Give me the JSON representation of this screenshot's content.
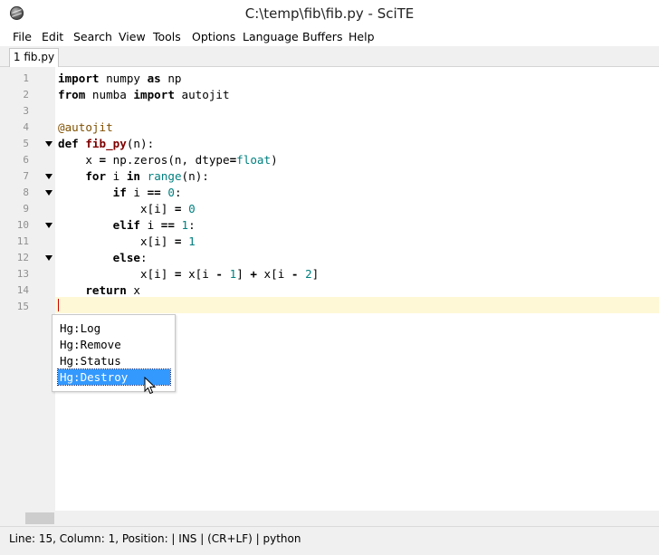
{
  "window": {
    "title": "C:\\temp\\fib\\fib.py - SciTE"
  },
  "menu": [
    "File",
    "Edit",
    "Search",
    "View",
    "Tools",
    "Options",
    "Language",
    "Buffers",
    "Help"
  ],
  "tabs": [
    {
      "label": "1 fib.py"
    }
  ],
  "editor": {
    "line_numbers": [
      "1",
      "2",
      "3",
      "4",
      "5",
      "6",
      "7",
      "8",
      "9",
      "10",
      "11",
      "12",
      "13",
      "14",
      "15"
    ],
    "lines": [
      "import numpy as np",
      "from numba import autojit",
      "",
      "@autojit",
      "def fib_py(n):",
      "    x = np.zeros(n, dtype=float)",
      "    for i in range(n):",
      "        if i == 0:",
      "            x[i] = 0",
      "        elif i == 1:",
      "            x[i] = 1",
      "        else:",
      "            x[i] = x[i - 1] + x[i - 2]",
      "    return x",
      ""
    ],
    "current_line": 15
  },
  "autocomplete": {
    "items": [
      "Hg:Log",
      "Hg:Remove",
      "Hg:Status",
      "Hg:Destroy"
    ],
    "selected": "Hg:Destroy"
  },
  "status": {
    "text": "Line: 15, Column: 1, Position:  | INS | (CR+LF) | python"
  },
  "colors": {
    "selection": "#3399ff",
    "caret_line": "#fff8d6",
    "number": "#007f7f",
    "function_name": "#7f0000"
  }
}
